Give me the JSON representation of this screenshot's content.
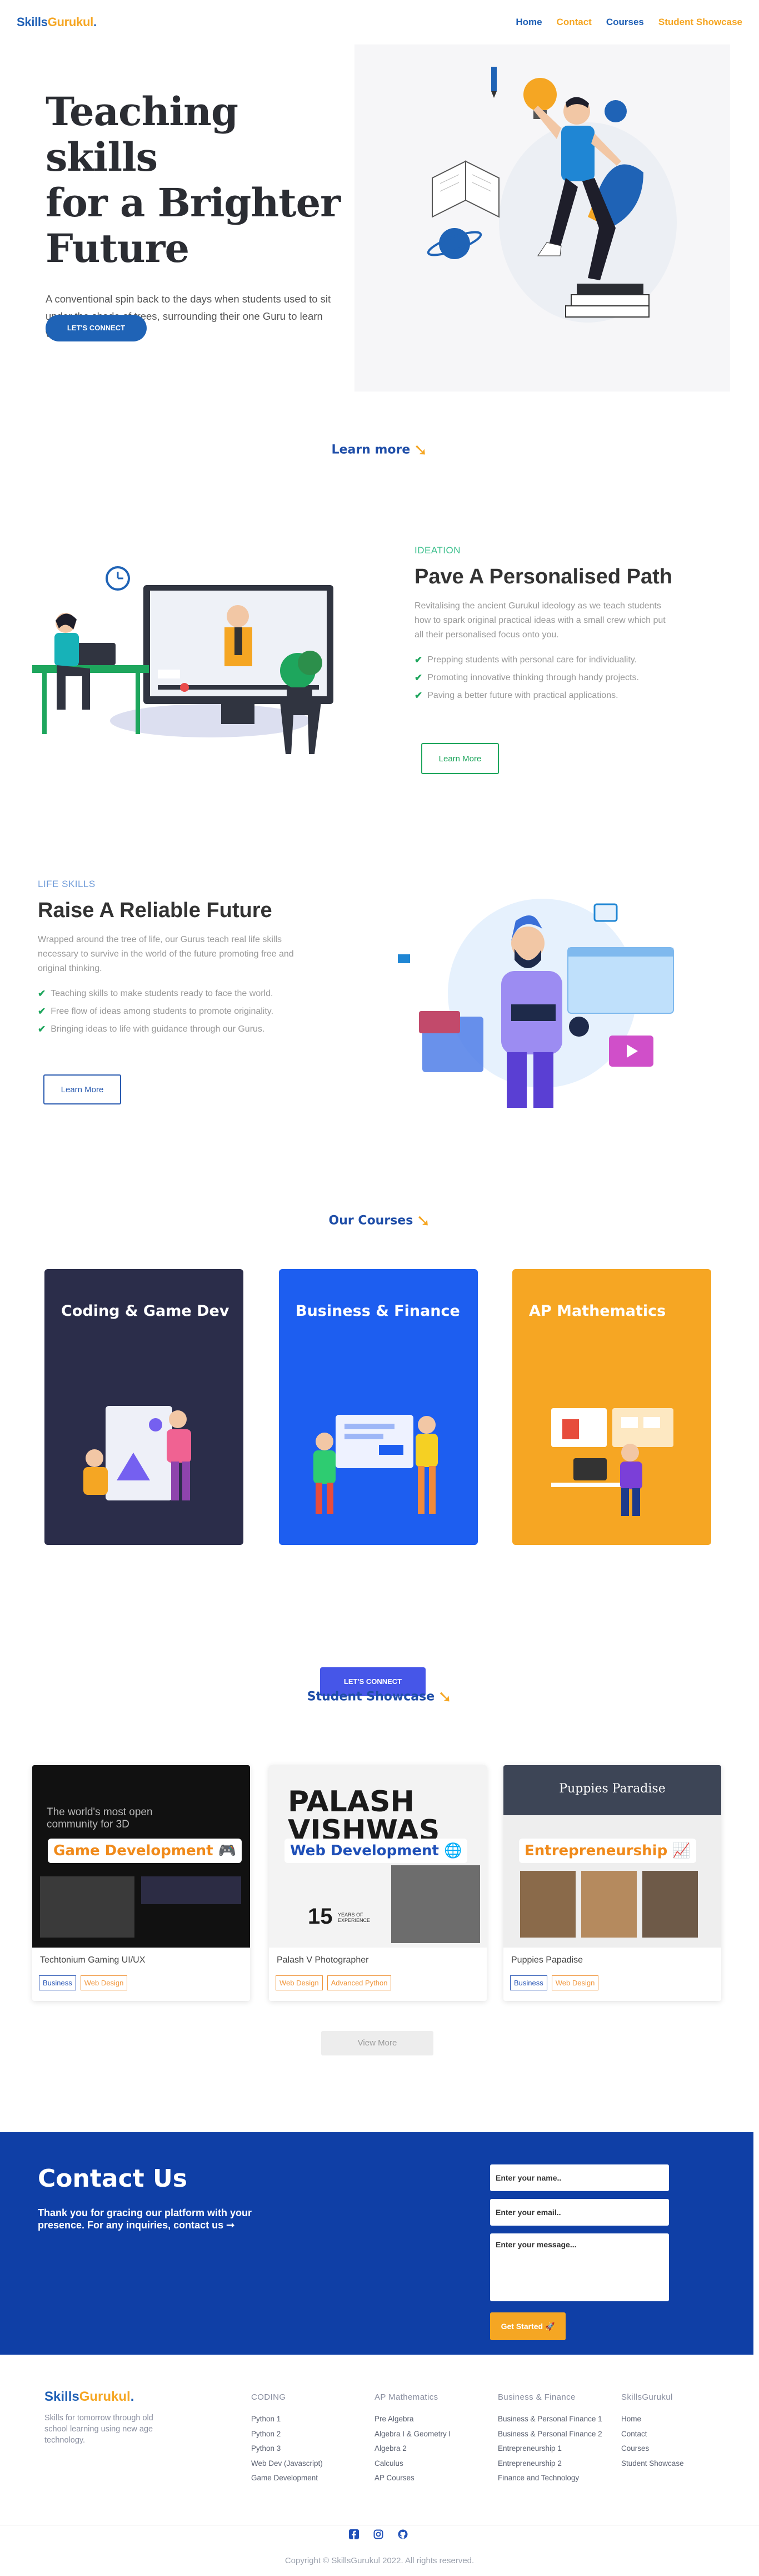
{
  "nav": {
    "logo_part1": "Skills",
    "logo_part2": "Gurukul",
    "logo_dot": ".",
    "links": [
      {
        "label": "Home",
        "color": "#1e5fb5"
      },
      {
        "label": "Contact",
        "color": "#f5a623"
      },
      {
        "label": "Courses",
        "color": "#1e5fb5"
      },
      {
        "label": "Student Showcase",
        "color": "#f5a623"
      }
    ]
  },
  "hero": {
    "title_line1": "Teaching skills",
    "title_line2": "for a Brighter",
    "title_line3": "Future",
    "description": "A conventional spin back to the days when students used to sit under the shade of trees, surrounding their one Guru to learn valuable life skills.",
    "cta": "LET'S CONNECT"
  },
  "learn_more": {
    "label": "Learn more",
    "arrow": "➘"
  },
  "ideation": {
    "eyebrow": "IDEATION",
    "title": "Pave A Personalised Path",
    "description": "Revitalising the ancient Gurukul ideology as we teach students how to spark original practical ideas with a small crew which put all their personalised focus onto you.",
    "bullets": [
      "Prepping students with personal care for individuality.",
      "Promoting innovative thinking through handy projects.",
      "Paving a better future with practical applications."
    ],
    "button": "Learn More",
    "check_icon": "check-icon"
  },
  "life_skills": {
    "eyebrow": "LIFE SKILLS",
    "title": "Raise A Reliable Future",
    "description": "Wrapped around the tree of life, our Gurus teach real life skills necessary to survive in the world of the future promoting free and original thinking.",
    "bullets": [
      "Teaching skills to make students ready to face the world.",
      "Free flow of ideas among students to promote originality.",
      "Bringing ideas to life with guidance through our Gurus."
    ],
    "button": "Learn More"
  },
  "courses": {
    "heading": "Our Courses",
    "arrow": "➘",
    "cards": [
      {
        "title": "Coding & Game Dev",
        "color": "#2b2d4a"
      },
      {
        "title": "Business & Finance",
        "color": "#1d5ef0"
      },
      {
        "title": "AP Mathematics",
        "color": "#f6a623"
      }
    ],
    "cta": "LET'S CONNECT"
  },
  "showcase": {
    "heading": "Student Showcase",
    "arrow": "➘",
    "cards": [
      {
        "name": "Techtonium Gaming UI/UX",
        "badge": "Game Development 🎮",
        "thumb_text": "The world's most open community for 3D",
        "tags": [
          {
            "label": "Business",
            "style": "blue"
          },
          {
            "label": "Web Design",
            "style": "orange"
          }
        ]
      },
      {
        "name": "Palash V Photographer",
        "badge": "Web Development 🌐",
        "thumb_text_1": "PALASH",
        "thumb_text_2": "VISHWAS",
        "thumb_text_3": "15",
        "thumb_text_4": "YEARS OF EXPERIENCE",
        "tags": [
          {
            "label": "Web Design",
            "style": "orange"
          },
          {
            "label": "Advanced Python",
            "style": "orange"
          }
        ]
      },
      {
        "name": "Puppies Papadise",
        "badge": "Entrepreneurship 📈",
        "thumb_text": "Puppies Paradise",
        "tags": [
          {
            "label": "Business",
            "style": "blue"
          },
          {
            "label": "Web Design",
            "style": "orange"
          }
        ]
      }
    ],
    "view_more": "View More"
  },
  "contact": {
    "title": "Contact Us",
    "description": "Thank you for gracing our platform with your presence. For any inquiries, contact us ➞",
    "name_placeholder": "Enter your name..",
    "email_placeholder": "Enter your email..",
    "message_placeholder": "Enter your message...",
    "button": "Get Started 🚀"
  },
  "footer": {
    "logo_part1": "Skills",
    "logo_part2": "Gurukul",
    "logo_dot": ".",
    "tagline": "Skills for tomorrow through old school learning using new age technology.",
    "columns": [
      {
        "heading": "CODING",
        "links": [
          "Python 1",
          "Python 2",
          "Python 3",
          "Web Dev (Javascript)",
          "Game Development"
        ]
      },
      {
        "heading": "AP Mathematics",
        "links": [
          "Pre Algebra",
          "Algebra I & Geometry I",
          "Algebra 2",
          "Calculus",
          "AP Courses"
        ]
      },
      {
        "heading": "Business & Finance",
        "links": [
          "Business & Personal Finance 1",
          "Business & Personal Finance 2",
          "Entrepreneurship 1",
          "Entrepreneurship 2",
          "Finance and Technology"
        ]
      },
      {
        "heading": "SkillsGurukul",
        "links": [
          "Home",
          "Contact",
          "Courses",
          "Student Showcase"
        ]
      }
    ],
    "socials": [
      "facebook-icon",
      "instagram-icon",
      "github-icon"
    ],
    "copyright": "Copyright © SkillsGurukul 2022. All rights reserved."
  }
}
